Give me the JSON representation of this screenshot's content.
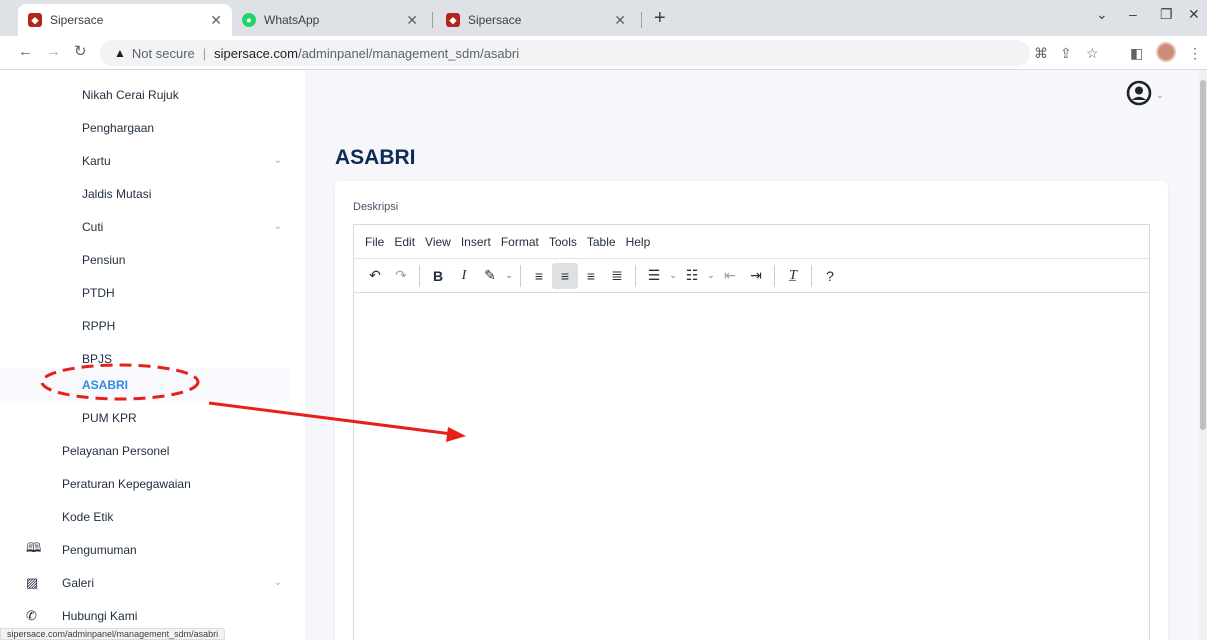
{
  "browser": {
    "tabs": [
      {
        "title": "Sipersace",
        "favicon": "sipersace-shield-icon"
      },
      {
        "title": "WhatsApp",
        "favicon": "whatsapp-icon"
      },
      {
        "title": "Sipersace",
        "favicon": "sipersace-shield-icon"
      }
    ],
    "address": {
      "security": "Not secure",
      "host": "sipersace.com",
      "path": "/adminpanel/management_sdm/asabri"
    },
    "status_url": "sipersace.com/adminpanel/management_sdm/asabri"
  },
  "sidebar": {
    "sub_items": [
      {
        "label": "Nikah Cerai Rujuk"
      },
      {
        "label": "Penghargaan"
      },
      {
        "label": "Kartu",
        "expandable": true
      },
      {
        "label": "Jaldis Mutasi"
      },
      {
        "label": "Cuti",
        "expandable": true
      },
      {
        "label": "Pensiun"
      },
      {
        "label": "PTDH"
      },
      {
        "label": "RPPH"
      },
      {
        "label": "BPJS"
      },
      {
        "label": "ASABRI",
        "active": true
      },
      {
        "label": "PUM KPR"
      }
    ],
    "top_items": [
      {
        "label": "Pelayanan Personel"
      },
      {
        "label": "Peraturan Kepegawaian"
      },
      {
        "label": "Kode Etik"
      },
      {
        "label": "Pengumuman",
        "icon": "book-icon"
      },
      {
        "label": "Galeri",
        "icon": "image-icon",
        "expandable": true
      },
      {
        "label": "Hubungi Kami",
        "icon": "phone-icon"
      }
    ]
  },
  "main": {
    "title": "ASABRI",
    "field_label": "Deskripsi",
    "editor": {
      "menu": [
        "File",
        "Edit",
        "View",
        "Insert",
        "Format",
        "Tools",
        "Table",
        "Help"
      ]
    }
  },
  "colors": {
    "accent": "#2e8be6",
    "title": "#0f2b55",
    "annotation": "#e8201a"
  }
}
